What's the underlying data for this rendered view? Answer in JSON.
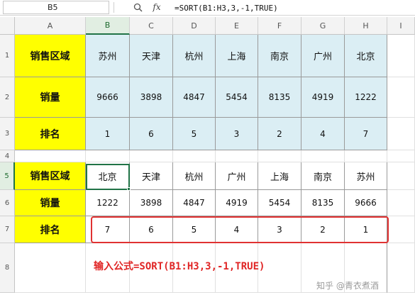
{
  "formula_bar": {
    "cell_ref": "B5",
    "zoom_icon": "magnifier-icon",
    "fx_label": "fx",
    "formula": "=SORT(B1:H3,3,-1,TRUE)"
  },
  "columns": [
    "A",
    "B",
    "C",
    "D",
    "E",
    "F",
    "G",
    "H",
    "I"
  ],
  "rows": [
    "1",
    "2",
    "3",
    "4",
    "5",
    "6",
    "7",
    "8"
  ],
  "selected": {
    "column": "B",
    "row": "5"
  },
  "table1": {
    "labels": [
      "销售区域",
      "销量",
      "排名"
    ],
    "regions": [
      "苏州",
      "天津",
      "杭州",
      "上海",
      "南京",
      "广州",
      "北京"
    ],
    "sales": [
      "9666",
      "3898",
      "4847",
      "5454",
      "8135",
      "4919",
      "1222"
    ],
    "ranks": [
      "1",
      "6",
      "5",
      "3",
      "2",
      "4",
      "7"
    ]
  },
  "table2": {
    "labels": [
      "销售区域",
      "销量",
      "排名"
    ],
    "regions": [
      "北京",
      "天津",
      "杭州",
      "广州",
      "上海",
      "南京",
      "苏州"
    ],
    "sales": [
      "1222",
      "3898",
      "4847",
      "4919",
      "5454",
      "8135",
      "9666"
    ],
    "ranks": [
      "7",
      "6",
      "5",
      "4",
      "3",
      "2",
      "1"
    ]
  },
  "annotation": "输入公式=SORT(B1:H3,3,-1,TRUE)",
  "watermark": "知乎 @青衣煮酒",
  "colors": {
    "label_fill": "#ffff00",
    "table1_fill": "#dbeef4",
    "selection_green": "#217346",
    "highlight_red": "#e03232"
  }
}
